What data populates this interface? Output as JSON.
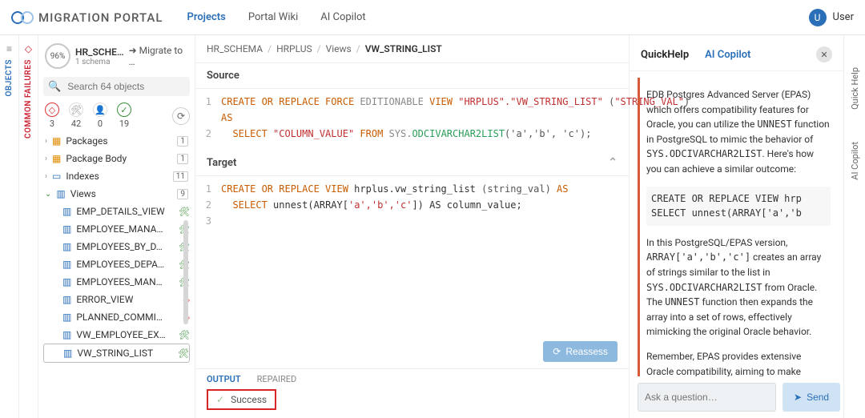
{
  "brand": {
    "title": "MIGRATION PORTAL"
  },
  "topnav": {
    "projects": "Projects",
    "wiki": "Portal Wiki",
    "copilot": "AI Copilot"
  },
  "user": {
    "initial": "U",
    "label": "User"
  },
  "rails": {
    "objects": "OBJECTS",
    "failures": "COMMON FAILURES",
    "quickhelp": "Quick Help",
    "aicopilot": "AI Copilot"
  },
  "sidebar": {
    "schema_title": "HR_SCHE…",
    "schema_sub": "1 schema",
    "pct": "96%",
    "migrate": "Migrate to …",
    "search_placeholder": "Search 64 objects",
    "counts": {
      "red": "3",
      "tool": "42",
      "person": "0",
      "check": "19"
    },
    "nodes": {
      "packages": {
        "label": "Packages",
        "count": "1"
      },
      "package_body": {
        "label": "Package Body",
        "count": "1"
      },
      "indexes": {
        "label": "Indexes",
        "count": "11"
      },
      "views": {
        "label": "Views",
        "count": "9"
      }
    },
    "views_children": [
      {
        "name": "EMP_DETAILS_VIEW",
        "status": "ok"
      },
      {
        "name": "EMPLOYEE_MANA…",
        "status": "ok"
      },
      {
        "name": "EMPLOYEES_BY_D…",
        "status": "ok"
      },
      {
        "name": "EMPLOYEES_DEPA…",
        "status": "ok"
      },
      {
        "name": "EMPLOYEES_MAN…",
        "status": "ok"
      },
      {
        "name": "ERROR_VIEW",
        "status": "bad"
      },
      {
        "name": "PLANNED_COMMI…",
        "status": "bad"
      },
      {
        "name": "VW_EMPLOYEE_EX…",
        "status": "ok"
      },
      {
        "name": "VW_STRING_LIST",
        "status": "ok"
      }
    ]
  },
  "crumbs": {
    "a": "HR_SCHEMA",
    "b": "HRPLUS",
    "c": "Views",
    "d": "VW_STRING_LIST"
  },
  "sections": {
    "source": "Source",
    "target": "Target"
  },
  "source_code": {
    "l1_a": "CREATE OR REPLACE FORCE",
    "l1_editionable": " EDITIONABLE",
    "l1_view": " VIEW ",
    "l1_obj": "\"HRPLUS\".\"VW_STRING_LIST\"",
    "l1_paren_open": " (",
    "l1_col": "\"STRING_VAL\"",
    "l1_paren_close": ")",
    "l1_as": "AS",
    "l2_a": "  SELECT ",
    "l2_col": "\"COLUMN_VALUE\"",
    "l2_from": " FROM ",
    "l2_sys": "SYS.",
    "l2_fn": "ODCIVARCHAR2LIST",
    "l2_args": "('a','b', 'c');"
  },
  "target_code": {
    "l1_kw": "CREATE OR REPLACE VIEW ",
    "l1_obj": "hrplus.vw_string_list ",
    "l1_paren": "(string_val) ",
    "l1_as": "AS",
    "l2_a": "  SELECT ",
    "l2_fn": "unnest",
    "l2_args": "(ARRAY[",
    "l2_vals": "'a','b','c'",
    "l2_end": "]) AS column_value;"
  },
  "reassess": "Reassess",
  "output_tabs": {
    "output": "OUTPUT",
    "repaired": "REPAIRED"
  },
  "output_body": {
    "success": "Success"
  },
  "right": {
    "tab1": "QuickHelp",
    "tab2": "AI Copilot",
    "p1": "EDB Postgres Advanced Server (EPAS) which offers compatibility features for Oracle, you can utilize the ",
    "p1b": "UNNEST",
    "p1c": " function in PostgreSQL to mimic the behavior of ",
    "p1d": "SYS.ODCIVARCHAR2LIST",
    "p1e": ". Here's how you can achieve a similar outcome:",
    "code1": "CREATE OR REPLACE VIEW hrp",
    "code2": "SELECT unnest(ARRAY['a','b",
    "p2": "In this PostgreSQL/EPAS version, ",
    "p2b": "ARRAY['a','b','c']",
    "p2c": " creates an array of strings similar to the list in ",
    "p2d": "SYS.ODCIVARCHAR2LIST",
    "p2e": " from Oracle. The ",
    "p2f": "UNNEST",
    "p2g": " function then expands the array into a set of rows, effectively mimicking the original Oracle behavior.",
    "p3": "Remember, EPAS provides extensive Oracle compatibility, aiming to make migrations smoother by supporting Oracle-like syntax and features directly. However, for specific Oracle",
    "ask_placeholder": "Ask a question…",
    "send": "Send"
  }
}
